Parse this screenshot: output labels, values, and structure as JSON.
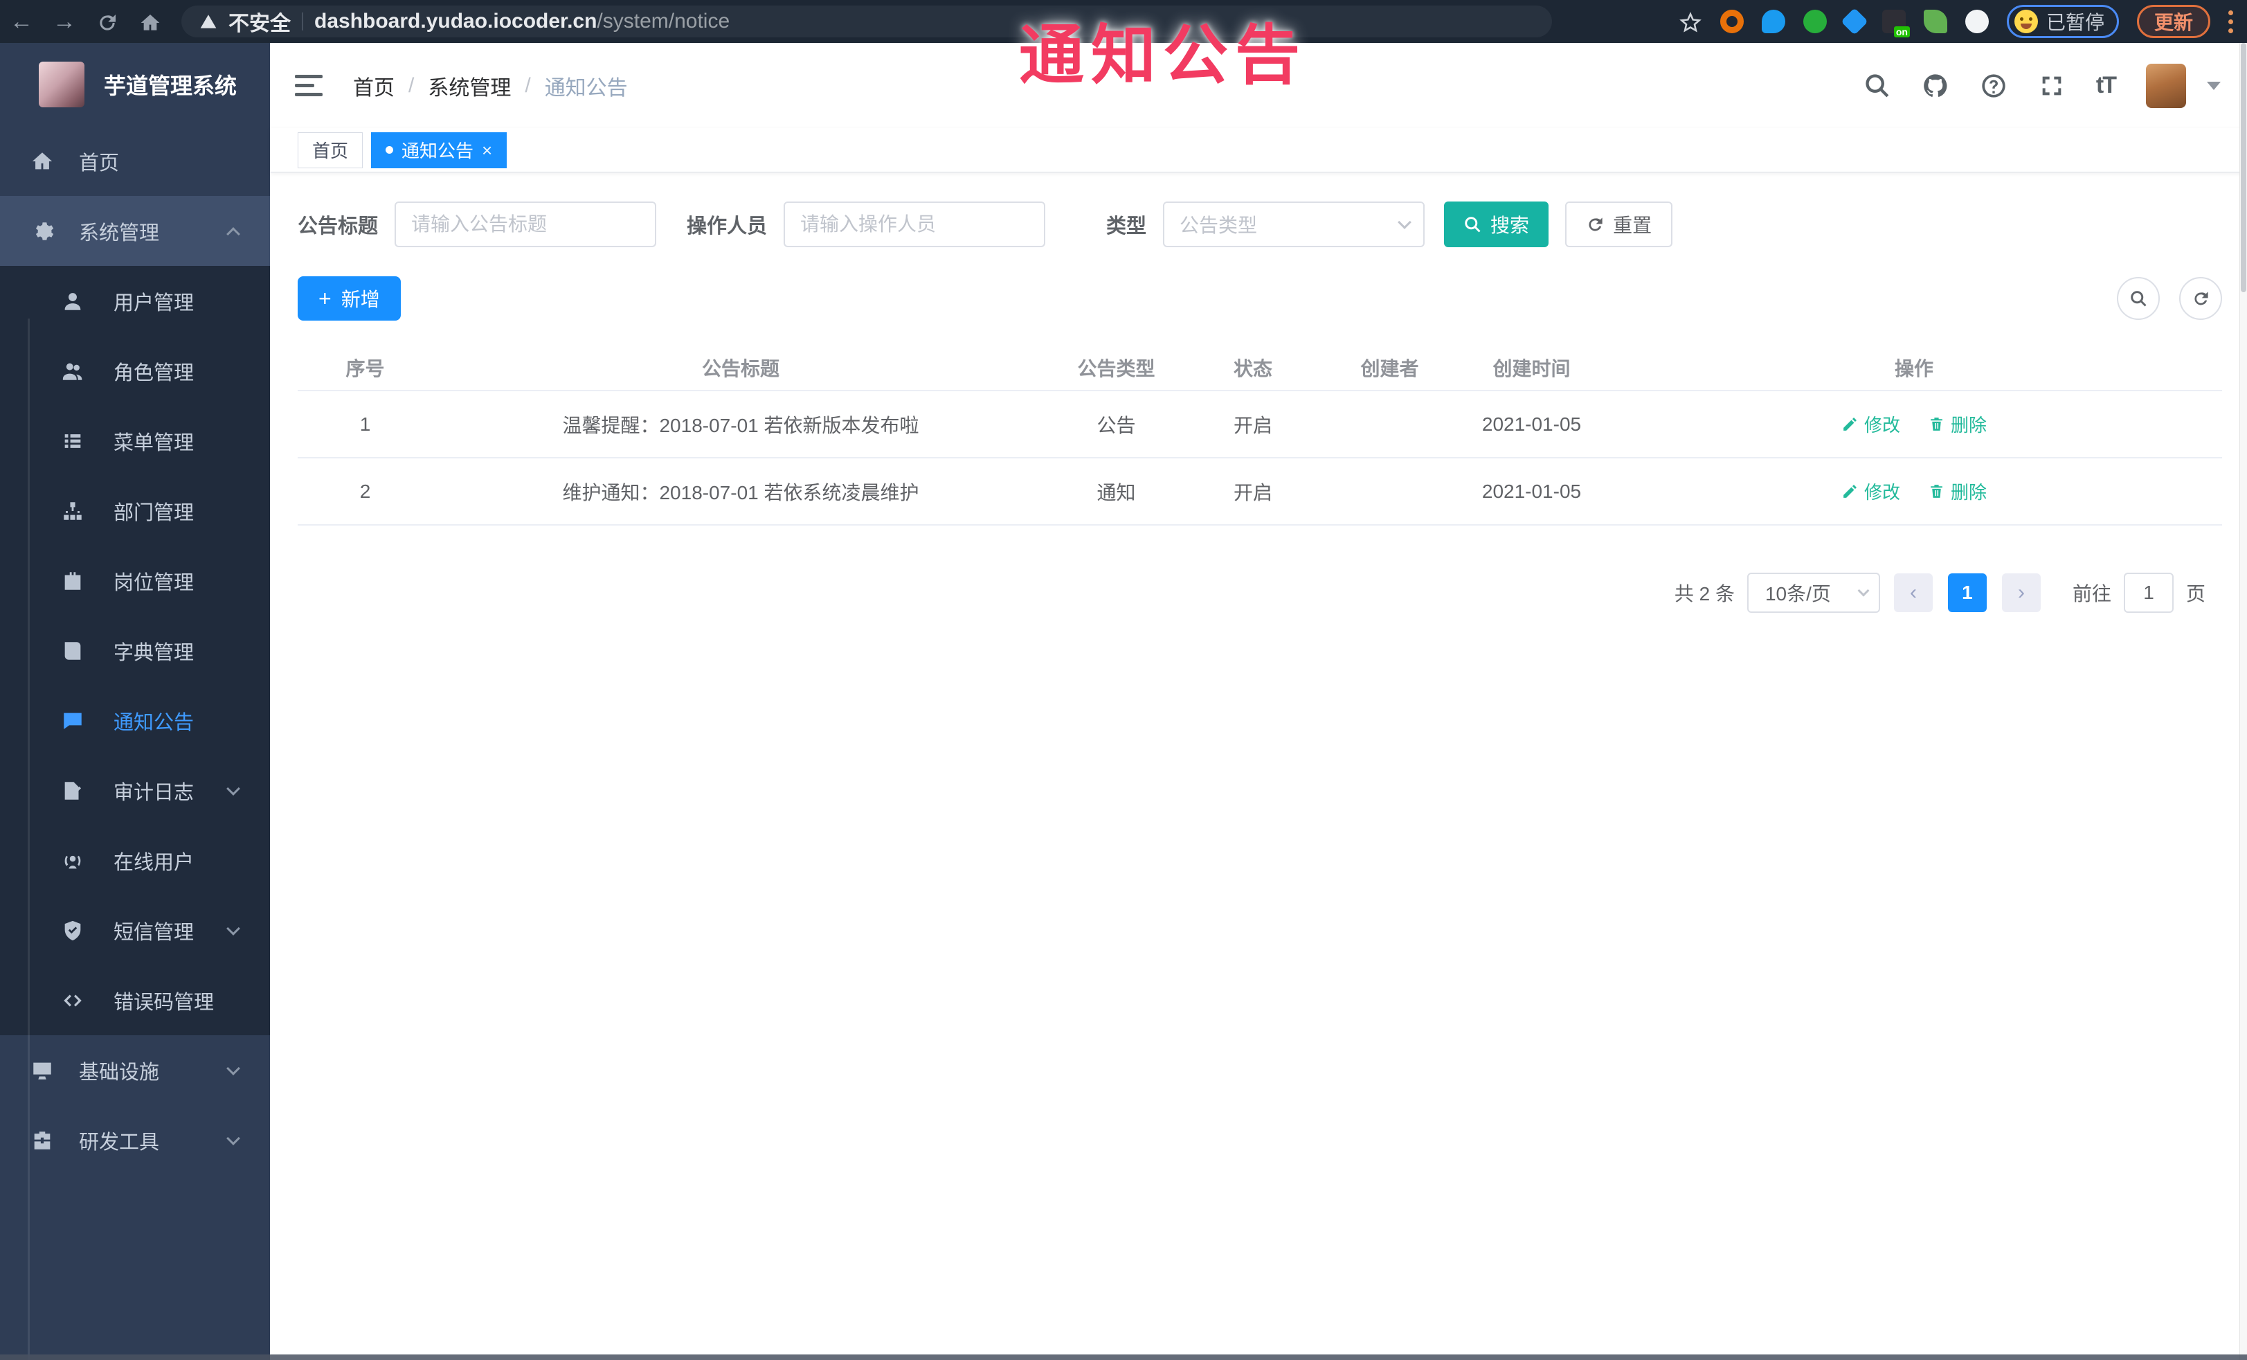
{
  "colors": {
    "accent_blue": "#1890ff",
    "teal": "#17b3a3",
    "action_link": "#23ba9b",
    "sidebar_active": "#3f9bff",
    "overlay_pink": "#f23b61"
  },
  "browser": {
    "security_label": "不安全",
    "url_host": "dashboard.yudao.iocoder.cn",
    "url_path": "/system/notice",
    "ext_badge": "on",
    "profile_label": "已暂停",
    "update_label": "更新"
  },
  "overlay": {
    "title": "通知公告"
  },
  "sidebar": {
    "app_title": "芋道管理系统",
    "items": [
      {
        "label": "首页",
        "icon": "home-icon"
      },
      {
        "label": "系统管理",
        "icon": "gear-icon"
      },
      {
        "label": "用户管理",
        "icon": "user-icon"
      },
      {
        "label": "角色管理",
        "icon": "users-icon"
      },
      {
        "label": "菜单管理",
        "icon": "list-icon"
      },
      {
        "label": "部门管理",
        "icon": "org-icon"
      },
      {
        "label": "岗位管理",
        "icon": "badge-icon"
      },
      {
        "label": "字典管理",
        "icon": "book-icon"
      },
      {
        "label": "通知公告",
        "icon": "chat-icon"
      },
      {
        "label": "审计日志",
        "icon": "log-icon"
      },
      {
        "label": "在线用户",
        "icon": "online-icon"
      },
      {
        "label": "短信管理",
        "icon": "shield-icon"
      },
      {
        "label": "错误码管理",
        "icon": "code-icon"
      },
      {
        "label": "基础设施",
        "icon": "monitor-icon"
      },
      {
        "label": "研发工具",
        "icon": "toolbox-icon"
      }
    ]
  },
  "topbar": {
    "breadcrumb": [
      "首页",
      "系统管理",
      "通知公告"
    ],
    "font_icon_text": "tT"
  },
  "tabs": [
    {
      "label": "首页"
    },
    {
      "label": "通知公告"
    }
  ],
  "filters": {
    "title_label": "公告标题",
    "title_placeholder": "请输入公告标题",
    "operator_label": "操作人员",
    "operator_placeholder": "请输入操作人员",
    "type_label": "类型",
    "type_placeholder": "公告类型",
    "search_label": "搜索",
    "reset_label": "重置"
  },
  "toolbar": {
    "add_label": "新增"
  },
  "table": {
    "columns": [
      "序号",
      "公告标题",
      "公告类型",
      "状态",
      "创建者",
      "创建时间",
      "操作"
    ],
    "rows": [
      {
        "index": "1",
        "title": "温馨提醒：2018-07-01 若依新版本发布啦",
        "type": "公告",
        "status": "开启",
        "creator": "",
        "created": "2021-01-05"
      },
      {
        "index": "2",
        "title": "维护通知：2018-07-01 若依系统凌晨维护",
        "type": "通知",
        "status": "开启",
        "creator": "",
        "created": "2021-01-05"
      }
    ],
    "edit_label": "修改",
    "delete_label": "删除"
  },
  "pagination": {
    "total_text": "共 2 条",
    "page_size": "10条/页",
    "current_page": "1",
    "goto_label": "前往",
    "goto_value": "1",
    "page_unit": "页"
  }
}
